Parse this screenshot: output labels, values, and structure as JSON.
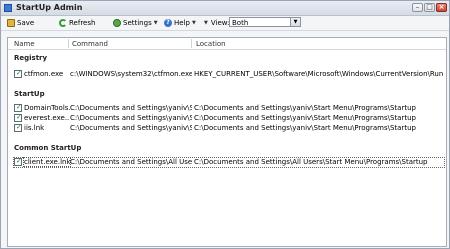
{
  "window": {
    "title": "StartUp Admin"
  },
  "toolbar": {
    "save": "Save",
    "refresh": "Refresh",
    "settings": "Settings",
    "help": "Help",
    "view_label": "View:",
    "view_value": "Both"
  },
  "columns": {
    "name": "Name",
    "command": "Command",
    "location": "Location"
  },
  "groups": {
    "registry": "Registry",
    "startup": "StartUp",
    "common": "Common StartUp"
  },
  "rows": {
    "registry": [
      {
        "name": "ctfmon.exe",
        "command": "c:\\WINDOWS\\system32\\ctfmon.exe",
        "location": "HKEY_CURRENT_USER\\Software\\Microsoft\\Windows\\CurrentVersion\\Run"
      }
    ],
    "startup": [
      {
        "name": "DomainTools...",
        "command": "C:\\Documents and Settings\\yaniv\\Start...",
        "location": "C:\\Documents and Settings\\yaniv\\Start Menu\\Programs\\Startup"
      },
      {
        "name": "everest.exe...",
        "command": "C:\\Documents and Settings\\yaniv\\Start...",
        "location": "C:\\Documents and Settings\\yaniv\\Start Menu\\Programs\\Startup"
      },
      {
        "name": "iis.lnk",
        "command": "C:\\Documents and Settings\\yaniv\\Start...",
        "location": "C:\\Documents and Settings\\yaniv\\Start Menu\\Programs\\Startup"
      }
    ],
    "common": [
      {
        "name": "client.exe.lnk",
        "command": "C:\\Documents and Settings\\All Users\\St...",
        "location": "C:\\Documents and Settings\\All Users\\Start Menu\\Programs\\Startup"
      }
    ]
  }
}
